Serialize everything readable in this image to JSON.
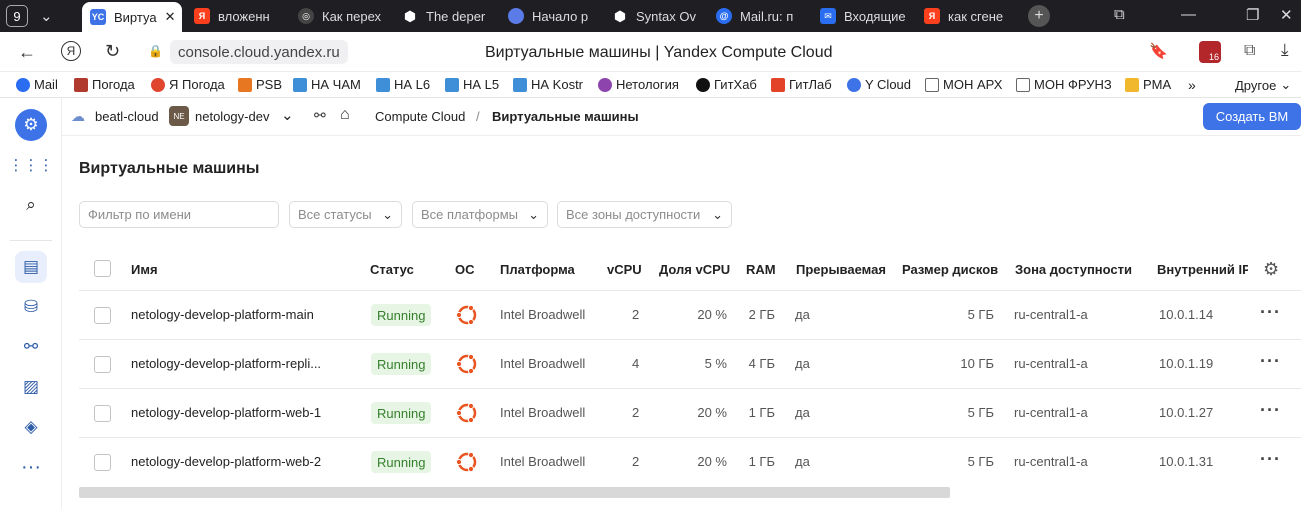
{
  "browser": {
    "tab_count": "9",
    "tabs": [
      {
        "label": "Виртуа",
        "icon": "yc-icon",
        "active": true
      },
      {
        "label": "вложенн",
        "icon": "yandex-icon"
      },
      {
        "label": "Как перех",
        "icon": "compass-icon"
      },
      {
        "label": "The deper",
        "icon": "hashicorp-icon"
      },
      {
        "label": "Начало р",
        "icon": "circle-icon"
      },
      {
        "label": "Syntax Ov",
        "icon": "hashicorp-icon"
      },
      {
        "label": "Mail.ru: п",
        "icon": "mailru-icon"
      },
      {
        "label": "Входящие",
        "icon": "mail-icon"
      },
      {
        "label": "как сгене",
        "icon": "yandex-icon"
      }
    ],
    "url": "console.cloud.yandex.ru",
    "page_title": "Виртуальные машины | Yandex Compute Cloud",
    "notif_count": "16",
    "bookmarks": [
      {
        "label": "Mail"
      },
      {
        "label": "Погода"
      },
      {
        "label": "Я Погода"
      },
      {
        "label": "PSB"
      },
      {
        "label": "НА ЧАМ"
      },
      {
        "label": "НА L6"
      },
      {
        "label": "НА L5"
      },
      {
        "label": "НА Kostr"
      },
      {
        "label": "Нетология"
      },
      {
        "label": "ГитХаб"
      },
      {
        "label": "ГитЛаб"
      },
      {
        "label": "Y Cloud"
      },
      {
        "label": "МОН АРХ"
      },
      {
        "label": "МОН ФРУНЗ"
      },
      {
        "label": "PMA"
      }
    ],
    "bookmarks_other": "Другое"
  },
  "console": {
    "cloud": "beatl-cloud",
    "folder_badge": "NE",
    "folder": "netology-dev",
    "breadcrumb_service": "Compute Cloud",
    "breadcrumb_sep": "/",
    "breadcrumb_page": "Виртуальные машины",
    "create_button": "Создать ВМ",
    "heading": "Виртуальные машины",
    "filter_placeholder": "Фильтр по имени",
    "status_filter": "Все статусы",
    "platform_filter": "Все платформы",
    "zone_filter": "Все зоны доступности"
  },
  "table": {
    "headers": {
      "name": "Имя",
      "status": "Статус",
      "os": "ОС",
      "platform": "Платформа",
      "vcpu": "vCPU",
      "share": "Доля vCPU",
      "ram": "RAM",
      "preemptible": "Прерываемая",
      "disk": "Размер дисков",
      "zone": "Зона доступности",
      "ip": "Внутренний IPv"
    },
    "rows": [
      {
        "name": "netology-develop-platform-main",
        "status": "Running",
        "platform": "Intel Broadwell",
        "vcpu": "2",
        "share": "20 %",
        "ram": "2 ГБ",
        "preemptible": "да",
        "disk": "5 ГБ",
        "zone": "ru-central1-a",
        "ip": "10.0.1.14"
      },
      {
        "name": "netology-develop-platform-repli...",
        "status": "Running",
        "platform": "Intel Broadwell",
        "vcpu": "4",
        "share": "5 %",
        "ram": "4 ГБ",
        "preemptible": "да",
        "disk": "10 ГБ",
        "zone": "ru-central1-a",
        "ip": "10.0.1.19"
      },
      {
        "name": "netology-develop-platform-web-1",
        "status": "Running",
        "platform": "Intel Broadwell",
        "vcpu": "2",
        "share": "20 %",
        "ram": "1 ГБ",
        "preemptible": "да",
        "disk": "5 ГБ",
        "zone": "ru-central1-a",
        "ip": "10.0.1.27"
      },
      {
        "name": "netology-develop-platform-web-2",
        "status": "Running",
        "platform": "Intel Broadwell",
        "vcpu": "2",
        "share": "20 %",
        "ram": "1 ГБ",
        "preemptible": "да",
        "disk": "5 ГБ",
        "zone": "ru-central1-a",
        "ip": "10.0.1.31"
      }
    ]
  },
  "colors": {
    "accent": "#3d73e7",
    "running_bg": "#e7f5e4",
    "running_text": "#36802d",
    "ubuntu": "#e95420"
  }
}
